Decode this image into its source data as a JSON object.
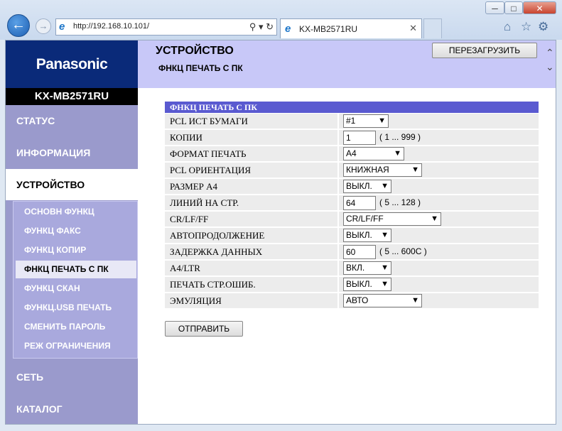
{
  "browser": {
    "url": "http://192.168.10.101/",
    "tab_title": "KX-MB2571RU",
    "minimize": "─",
    "maximize": "□",
    "close": "✕"
  },
  "brand": {
    "logo": "Panasonic",
    "model": "KX-MB2571RU"
  },
  "header": {
    "title": "УСТРОЙСТВО",
    "subtitle": "ФНКЦ ПЕЧАТЬ С ПК",
    "reload_label": "ПЕРЕЗАГРУЗИТЬ"
  },
  "nav": {
    "status": "СТАТУС",
    "info": "ИНФОРМАЦИЯ",
    "device": "УСТРОЙСТВО",
    "network": "СЕТЬ",
    "catalog": "КАТАЛОГ",
    "sub": [
      "ОСНОВН ФУНКЦ",
      "ФУНКЦ ФАКС",
      "ФУНКЦ КОПИР",
      "ФНКЦ ПЕЧАТЬ С ПК",
      "ФУНКЦ СКАН",
      "ФУНКЦ.USB ПЕЧАТЬ",
      "СМЕНИТЬ ПАРОЛЬ",
      "РЕЖ ОГРАНИЧЕНИЯ"
    ]
  },
  "form": {
    "section_title": "ФНКЦ ПЕЧАТЬ С ПК",
    "rows": [
      {
        "label": "PCL ИСТ БУМАГИ",
        "value": "#1"
      },
      {
        "label": "КОПИИ",
        "value": "1",
        "hint": "( 1 ... 999 )"
      },
      {
        "label": "ФОРМАТ ПЕЧАТЬ",
        "value": "A4"
      },
      {
        "label": "PCL ОРИЕНТАЦИЯ",
        "value": "КНИЖНАЯ"
      },
      {
        "label": "РАЗМЕР A4",
        "value": "ВЫКЛ."
      },
      {
        "label": "ЛИНИЙ НА СТР.",
        "value": "64",
        "hint": "( 5 ... 128 )"
      },
      {
        "label": "CR/LF/FF",
        "value": "CR/LF/FF"
      },
      {
        "label": "АВТОПРОДОЛЖЕНИЕ",
        "value": "ВЫКЛ."
      },
      {
        "label": "ЗАДЕРЖКА ДАННЫХ",
        "value": "60",
        "hint": "( 5 ... 600С )"
      },
      {
        "label": "A4/LTR",
        "value": "ВКЛ."
      },
      {
        "label": "ПЕЧАТЬ СТР.ОШИБ.",
        "value": "ВЫКЛ."
      },
      {
        "label": "ЭМУЛЯЦИЯ",
        "value": "АВТО"
      }
    ],
    "submit_label": "ОТПРАВИТЬ"
  }
}
